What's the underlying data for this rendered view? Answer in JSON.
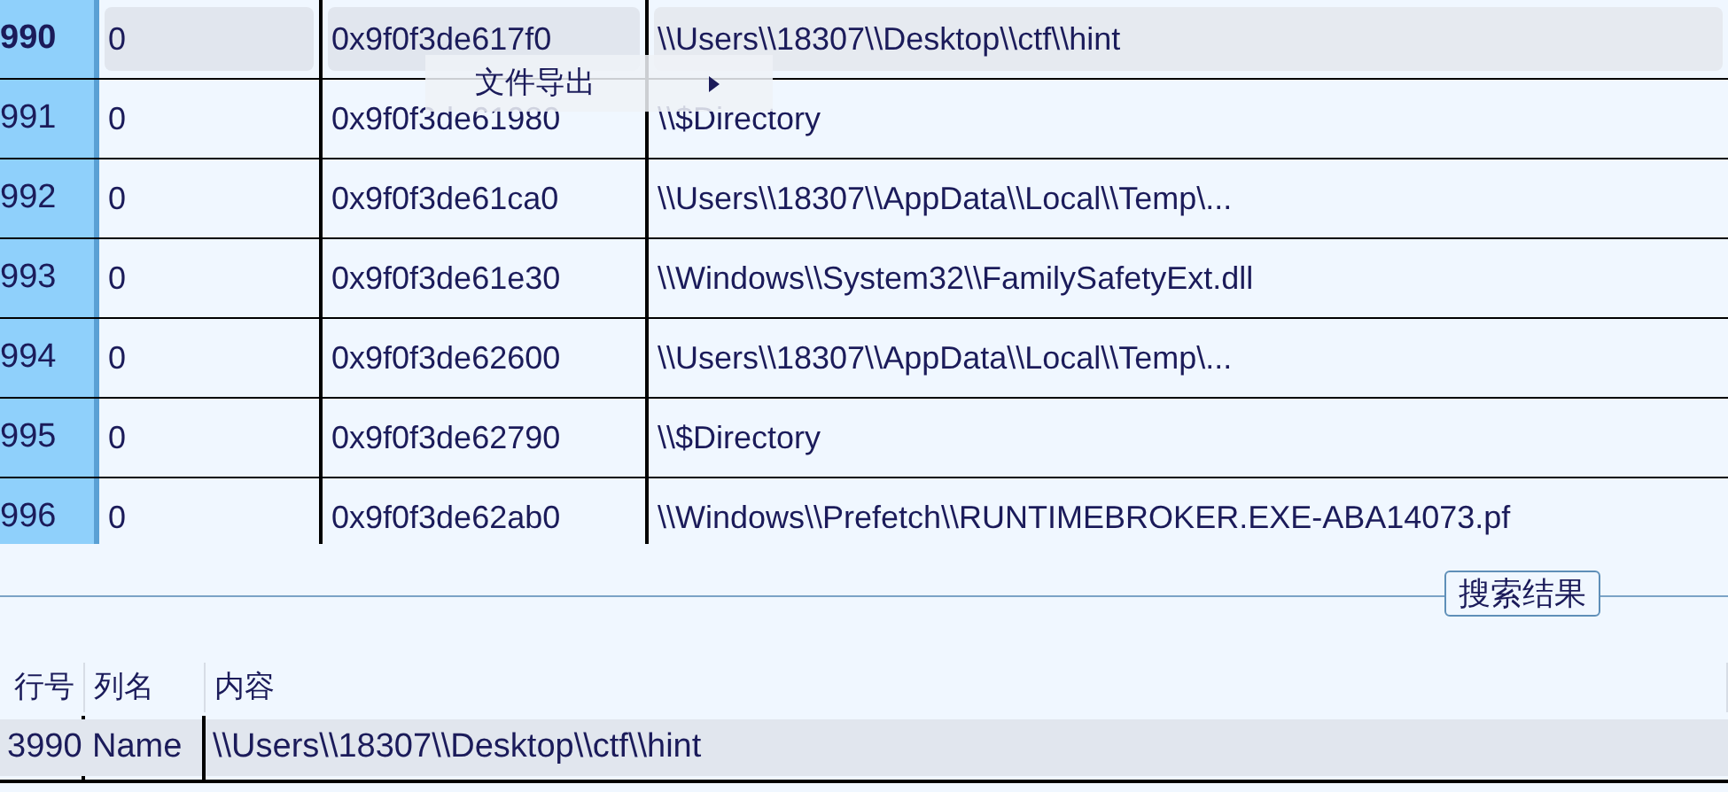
{
  "results_table": {
    "rows": [
      {
        "row_number": "990",
        "column_2": "0",
        "column_3": "0x9f0f3de617f0",
        "column_4": "\\\\Users\\\\18307\\\\Desktop\\\\ctf\\\\hint",
        "selected": true
      },
      {
        "row_number": "991",
        "column_2": "0",
        "column_3": "0x9f0f3de61980",
        "column_4": "\\\\$Directory",
        "selected": false
      },
      {
        "row_number": "992",
        "column_2": "0",
        "column_3": "0x9f0f3de61ca0",
        "column_4": "\\\\Users\\\\18307\\\\AppData\\\\Local\\\\Temp\\...",
        "selected": false
      },
      {
        "row_number": "993",
        "column_2": "0",
        "column_3": "0x9f0f3de61e30",
        "column_4": "\\\\Windows\\\\System32\\\\FamilySafetyExt.dll",
        "selected": false
      },
      {
        "row_number": "994",
        "column_2": "0",
        "column_3": "0x9f0f3de62600",
        "column_4": "\\\\Users\\\\18307\\\\AppData\\\\Local\\\\Temp\\...",
        "selected": false
      },
      {
        "row_number": "995",
        "column_2": "0",
        "column_3": "0x9f0f3de62790",
        "column_4": "\\\\$Directory",
        "selected": false
      },
      {
        "row_number": "996",
        "column_2": "0",
        "column_3": "0x9f0f3de62ab0",
        "column_4": "\\\\Windows\\\\Prefetch\\\\RUNTIMEBROKER.EXE-ABA14073.pf",
        "selected": false
      }
    ]
  },
  "context_menu": {
    "items": [
      {
        "label": "文件导出",
        "has_submenu": true
      }
    ]
  },
  "search_results_button": "搜索结果",
  "detail_table": {
    "columns": [
      "行号",
      "列名",
      "内容"
    ],
    "rows": [
      {
        "cells": [
          "3990",
          "Name",
          "\\\\Users\\\\18307\\\\Desktop\\\\ctf\\\\hint"
        ],
        "selected": true
      }
    ]
  }
}
